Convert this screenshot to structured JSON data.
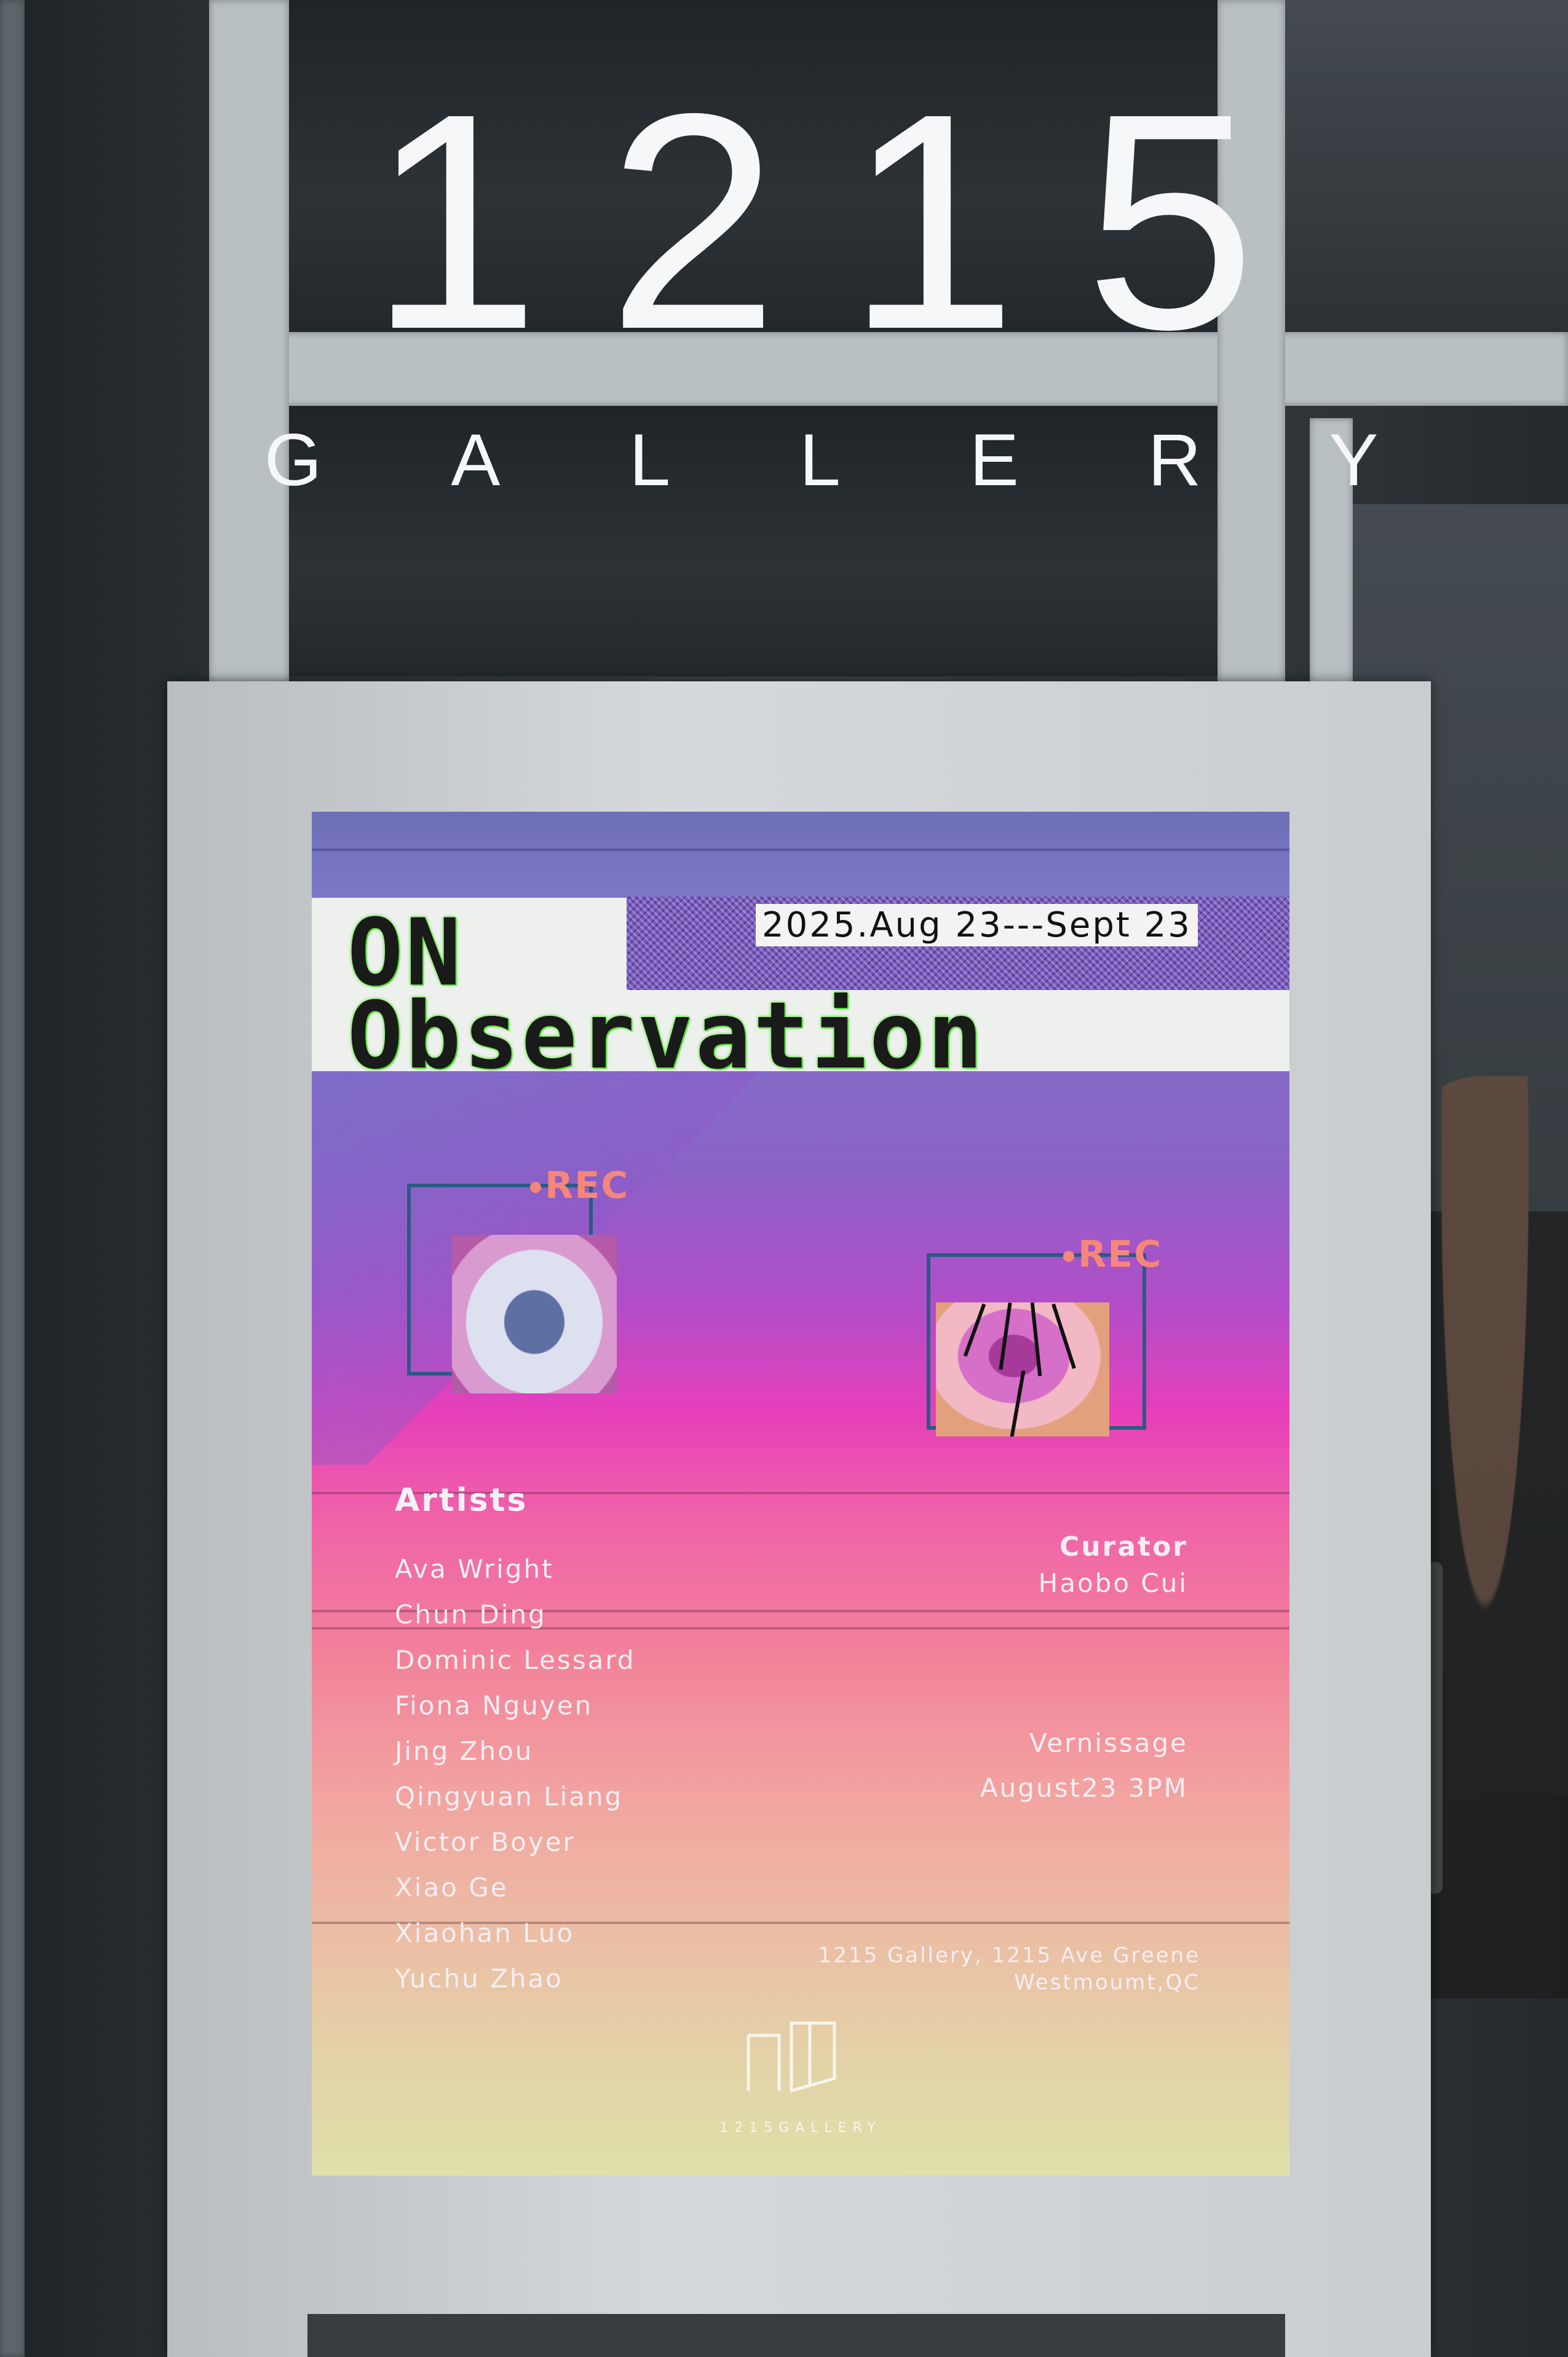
{
  "sign": {
    "number": "1215",
    "word": "GALLERY"
  },
  "poster": {
    "date": "2025.Aug 23---Sept 23",
    "title_line_1": "ON",
    "title_line_2": "Observation",
    "rec_label": "REC",
    "artists_heading": "Artists",
    "artists": [
      "Ava Wright",
      "Chun Ding",
      "Dominic Lessard",
      "Fiona Nguyen",
      "Jing Zhou",
      "Qingyuan Liang",
      "Victor Boyer",
      "Xiao Ge",
      "Xiaohan Luo",
      "Yuchu Zhao"
    ],
    "curator_heading": "Curator",
    "curator_name": "Haobo Cui",
    "vernissage_heading": "Vernissage",
    "vernissage_time": "August23 3PM",
    "address_line_1": "1215 Gallery, 1215 Ave Greene",
    "address_line_2": "Westmoumt,QC",
    "logo_text": "1215GALLERY"
  },
  "colors": {
    "rec": "#f7867a",
    "title_glow": "#52e03a",
    "camera_frame": "#2c5a86",
    "sign_text": "#f5f7f8"
  }
}
